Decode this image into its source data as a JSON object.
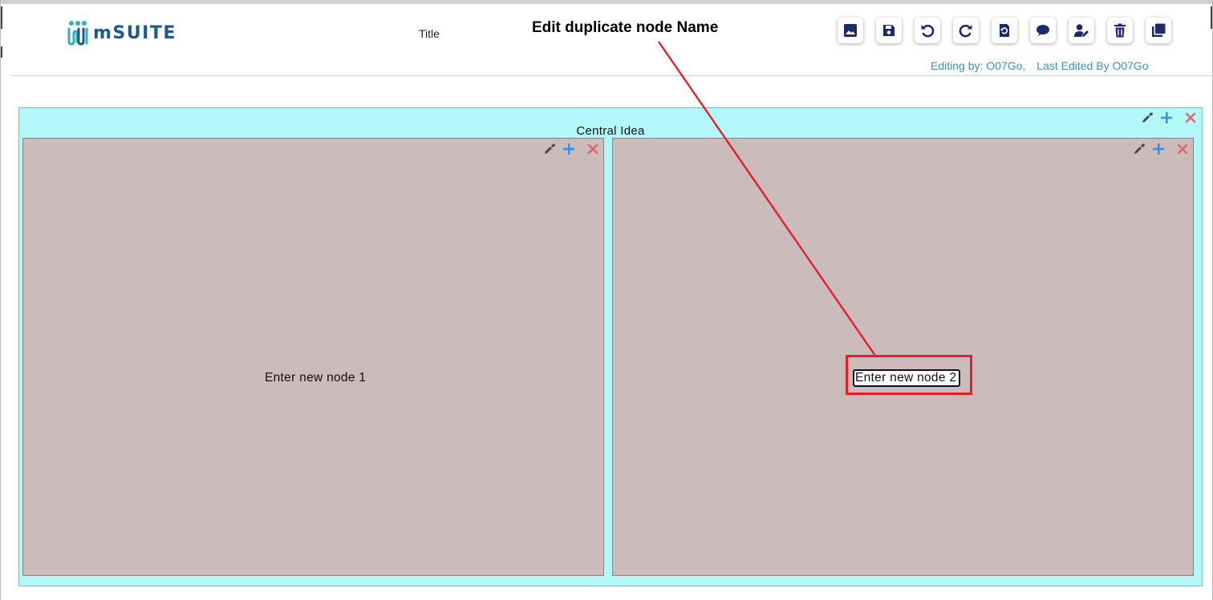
{
  "header": {
    "logo_text": "mSUITE",
    "doc_title": "Title",
    "editing_by": "Editing by: O07Go,",
    "last_edited_by": "Last Edited By O07Go"
  },
  "toolbar": {
    "buttons": [
      {
        "name": "image-button",
        "icon": "image-icon"
      },
      {
        "name": "save-button",
        "icon": "save-icon"
      },
      {
        "name": "undo-button",
        "icon": "undo-icon"
      },
      {
        "name": "redo-button",
        "icon": "redo-icon"
      },
      {
        "name": "restore-button",
        "icon": "restore-icon"
      },
      {
        "name": "comment-button",
        "icon": "comment-icon"
      },
      {
        "name": "edit-user-button",
        "icon": "user-edit-icon"
      },
      {
        "name": "delete-button",
        "icon": "trash-icon"
      },
      {
        "name": "duplicate-button",
        "icon": "copy-icon"
      }
    ]
  },
  "annotation": {
    "title": "Edit duplicate node Name",
    "color": "#e0202a"
  },
  "mindmap": {
    "central": {
      "label": "Central Idea",
      "color": "#b2f7fa"
    },
    "children": [
      {
        "label": "Enter new node 1",
        "color": "#cbbbbb",
        "editing": false
      },
      {
        "label": "Enter new node 2",
        "color": "#cbbbbb",
        "editing": true
      }
    ]
  },
  "colors": {
    "accent_text": "#3a93b8",
    "brand_dark": "#1c2a6b",
    "action_add": "#3b8fe6",
    "action_delete": "#e06666",
    "action_color": "#444444"
  }
}
